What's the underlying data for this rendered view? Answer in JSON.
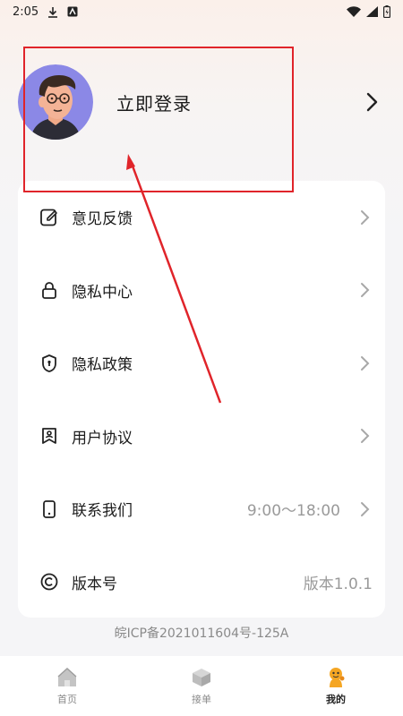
{
  "status_bar": {
    "time": "2:05",
    "icons": [
      "download-icon",
      "app-notification-icon",
      "wifi-icon",
      "signal-icon",
      "battery-icon"
    ]
  },
  "profile": {
    "login_label": "立即登录",
    "avatar_icon": "cartoon-avatar-icon",
    "chevron_icon": "chevron-right-icon"
  },
  "menu": {
    "items": [
      {
        "label": "意见反馈",
        "icon": "feedback-edit-icon",
        "value": "",
        "chevron": true
      },
      {
        "label": "隐私中心",
        "icon": "lock-icon",
        "value": "",
        "chevron": true
      },
      {
        "label": "隐私政策",
        "icon": "shield-icon",
        "value": "",
        "chevron": true
      },
      {
        "label": "用户协议",
        "icon": "bookmark-user-icon",
        "value": "",
        "chevron": true
      },
      {
        "label": "联系我们",
        "icon": "phone-icon",
        "value": "9:00～18:00",
        "chevron": true
      },
      {
        "label": "版本号",
        "icon": "copyright-icon",
        "value": "版本1.0.1",
        "chevron": false
      }
    ]
  },
  "icp": "皖ICP备2021011604号-125A",
  "bottom_nav": {
    "items": [
      {
        "label": "首页",
        "icon": "home-icon",
        "active": false
      },
      {
        "label": "接单",
        "icon": "box-icon",
        "active": false
      },
      {
        "label": "我的",
        "icon": "mascot-icon",
        "active": true
      }
    ]
  },
  "colors": {
    "annotation_red": "#e0242a",
    "mascot_orange": "#f5a623",
    "icon_gray": "#bcbcbc"
  }
}
